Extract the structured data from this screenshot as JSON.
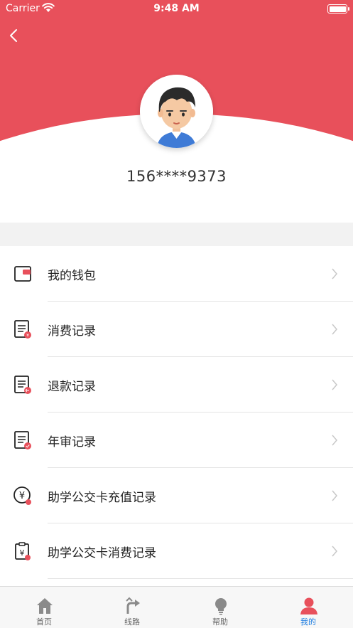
{
  "status_bar": {
    "carrier": "Carrier",
    "time": "9:48 AM"
  },
  "header": {
    "background_color": "#e8505b",
    "back_icon": "chevron-left-icon"
  },
  "profile": {
    "avatar_icon": "boy-avatar-icon",
    "phone": "156****9373"
  },
  "menu": {
    "items": [
      {
        "label": "我的钱包",
        "icon": "wallet-icon"
      },
      {
        "label": "消费记录",
        "icon": "consumption-record-icon"
      },
      {
        "label": "退款记录",
        "icon": "refund-record-icon"
      },
      {
        "label": "年审记录",
        "icon": "annual-review-record-icon"
      },
      {
        "label": "助学公交卡充值记录",
        "icon": "student-card-recharge-icon"
      },
      {
        "label": "助学公交卡消费记录",
        "icon": "student-card-consumption-icon"
      }
    ]
  },
  "tab_bar": {
    "active_color": "#1a7be0",
    "tabs": [
      {
        "label": "首页",
        "icon": "home-icon"
      },
      {
        "label": "线路",
        "icon": "route-icon"
      },
      {
        "label": "帮助",
        "icon": "lightbulb-icon"
      },
      {
        "label": "我的",
        "icon": "user-icon",
        "active": true
      }
    ]
  }
}
